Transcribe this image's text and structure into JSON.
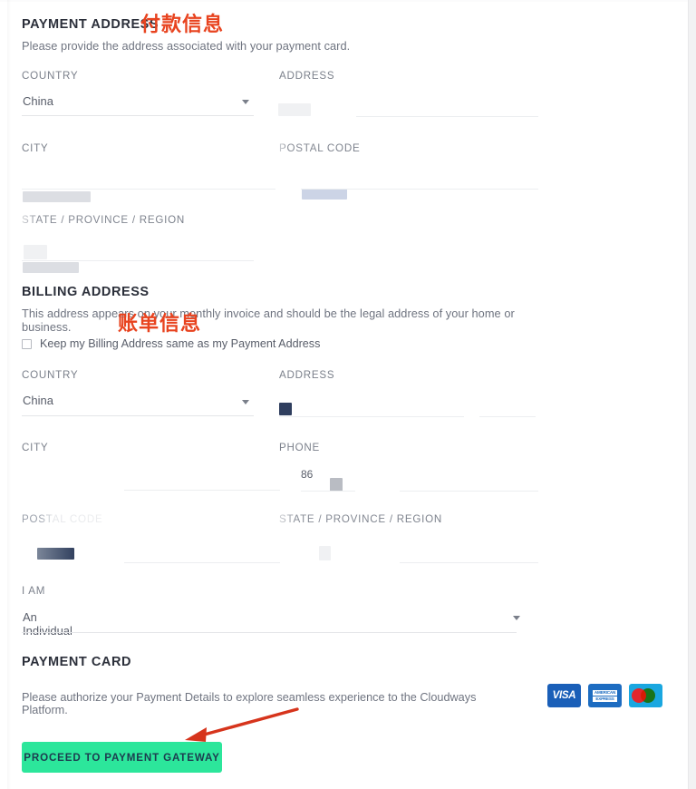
{
  "payment_address": {
    "heading": "PAYMENT ADDRESS",
    "annotation_cn": "付款信息",
    "description": "Please provide the address associated with your payment card.",
    "fields": {
      "country_label": "COUNTRY",
      "country_value": "China",
      "address_label": "ADDRESS",
      "city_label": "CITY",
      "postal_label": "POSTAL CODE",
      "state_label": "STATE / PROVINCE / REGION"
    }
  },
  "billing_address": {
    "heading": "BILLING ADDRESS",
    "annotation_cn": "账单信息",
    "description": "This address appears on your monthly invoice and should be the legal address of your home or business.",
    "checkbox_label": "Keep my Billing Address same as my Payment Address",
    "checkbox_checked": false,
    "fields": {
      "country_label": "COUNTRY",
      "country_value": "China",
      "address_label": "ADDRESS",
      "city_label": "CITY",
      "phone_label": "PHONE",
      "phone_prefix": "86",
      "postal_label": "POSTAL CODE",
      "state_label": "STATE / PROVINCE / REGION"
    },
    "i_am_label": "I AM",
    "i_am_value": "An Individual"
  },
  "payment_card": {
    "heading": "PAYMENT CARD",
    "note": "Please authorize your Payment Details to explore seamless experience to the Cloudways Platform.",
    "logos": [
      {
        "name": "visa",
        "text": "VISA"
      },
      {
        "name": "amex",
        "line1": "AMERICAN",
        "line2": "EXPRESS"
      },
      {
        "name": "mastercard",
        "text": ""
      }
    ],
    "cta_label": "PROCEED TO PAYMENT GATEWAY"
  },
  "colors": {
    "accent_green": "#2ce69b",
    "annotation_red": "#e8431f",
    "heading": "#2b2f3a",
    "label": "#7b808b"
  }
}
